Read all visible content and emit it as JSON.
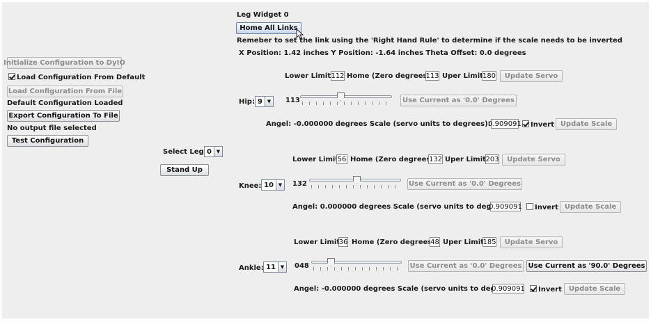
{
  "left": {
    "init_btn": "Initialize Configuration to DyIO",
    "load_default_chk": "Load Configuration From Default",
    "load_default_checked": true,
    "load_file_btn": "Load Configuration From File",
    "status_loaded": "Default Configuration Loaded",
    "export_btn": "Export Configuration To File",
    "no_output": "No output file selected",
    "test_btn": "Test Configuration"
  },
  "middle": {
    "select_leg_label": "Select Leg:",
    "select_leg_value": "0",
    "stand_up_btn": "Stand Up"
  },
  "widget": {
    "title": "Leg Widget 0",
    "home_all_btn": "Home All Links",
    "note": "Remeber to set the link using the 'Right Hand Rule' to determine if the scale needs to be inverted",
    "position": "X Position: 1.42 inches Y Position: -1.64 inches Theta Offset: 0.0 degrees"
  },
  "hip": {
    "name": "Hip:",
    "channel": "9",
    "lower_label": "Lower Limit:",
    "lower": "112",
    "home_label": "Home (Zero degrees):",
    "home": "113",
    "upper_label": "Uper Limit:",
    "upper": "180",
    "update_servo": "Update Servo",
    "slider_value": "113",
    "slider_fraction": 0.44,
    "use_zero_btn": "Use Current as '0.0' Degrees",
    "angel_text": "Angel: -0.000000 degrees Scale (servo units to degrees):",
    "scale": "0.909091",
    "invert_label": "Invert",
    "invert_checked": true,
    "update_scale": "Update Scale"
  },
  "knee": {
    "name": "Knee:",
    "channel": "10",
    "lower_label": "Lower Limit:",
    "lower": "56",
    "home_label": "Home (Zero degrees):",
    "home": "132",
    "upper_label": "Uper Limit:",
    "upper": "203",
    "update_servo": "Update Servo",
    "slider_value": "132",
    "slider_fraction": 0.52,
    "use_zero_btn": "Use Current as '0.0' Degrees",
    "angel_text": "Angel: 0.000000 degrees Scale (servo units to degrees):",
    "scale": "0.909091",
    "invert_label": "Invert",
    "invert_checked": false,
    "update_scale": "Update Scale"
  },
  "ankle": {
    "name": "Ankle:",
    "channel": "11",
    "lower_label": "Lower Limit:",
    "lower": "36",
    "home_label": "Home (Zero degrees):",
    "home": "48",
    "upper_label": "Uper Limit:",
    "upper": "185",
    "update_servo": "Update Servo",
    "slider_value": "048",
    "slider_fraction": 0.19,
    "use_zero_btn": "Use Current as '0.0' Degrees",
    "use_ninety_btn": "Use Current as '90.0' Degrees",
    "angel_text": "Angel: -0.000000 degrees Scale (servo units to degrees):",
    "scale": "0.909091",
    "invert_label": "Invert",
    "invert_checked": true,
    "update_scale": "Update Scale"
  }
}
